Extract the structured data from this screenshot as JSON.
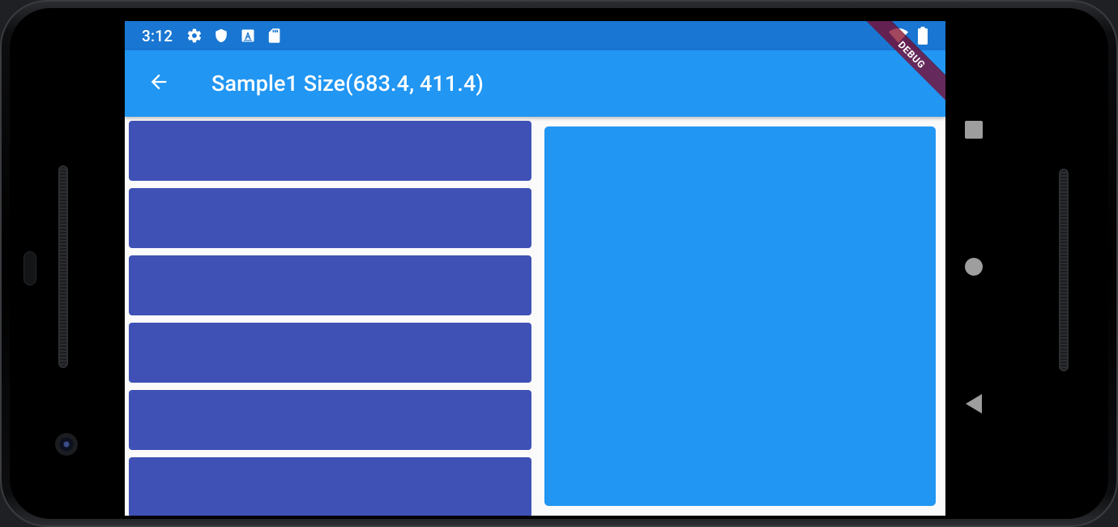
{
  "status_bar": {
    "time": "3:12",
    "left_icons": [
      "gear-icon",
      "shield-icon",
      "font-a-icon",
      "sd-card-icon"
    ],
    "right_icons": [
      "wifi-icon",
      "battery-icon"
    ]
  },
  "debug_banner": {
    "label": "DEBUG",
    "color": "#800020"
  },
  "app_bar": {
    "back_icon": "arrow-back-icon",
    "title": "Sample1 Size(683.4, 411.4)",
    "color": "#2196f3"
  },
  "list": {
    "item_color": "#3f51b5",
    "items": [
      {
        "label": ""
      },
      {
        "label": ""
      },
      {
        "label": ""
      },
      {
        "label": ""
      },
      {
        "label": ""
      },
      {
        "label": ""
      }
    ]
  },
  "detail_panel": {
    "color": "#2196f3"
  },
  "nav_bar": {
    "buttons": [
      "recents-square-icon",
      "home-circle-icon",
      "back-triangle-icon"
    ]
  }
}
